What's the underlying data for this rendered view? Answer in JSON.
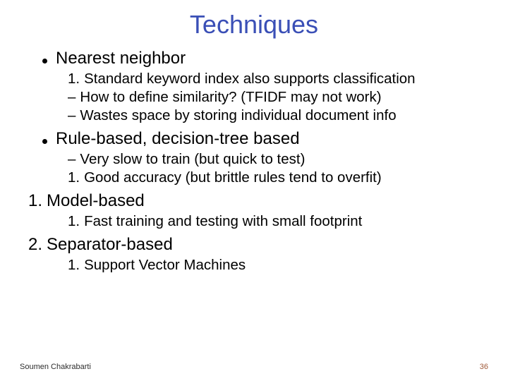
{
  "title": "Techniques",
  "sections": [
    {
      "style": "bullet",
      "heading": "Nearest neighbor",
      "items": [
        {
          "marker": "1.",
          "text": "Standard keyword index also supports classification"
        },
        {
          "marker": "–",
          "text": "How to define similarity? (TFIDF may not work)"
        },
        {
          "marker": "–",
          "text": "Wastes space by storing individual document info"
        }
      ]
    },
    {
      "style": "bullet",
      "heading": "Rule-based, decision-tree based",
      "items": [
        {
          "marker": "–",
          "text": "Very slow to train (but quick to test)"
        },
        {
          "marker": "1.",
          "text": "Good accuracy (but brittle rules tend to overfit)"
        }
      ]
    },
    {
      "style": "number",
      "number": "1.",
      "heading": "Model-based",
      "items": [
        {
          "marker": "1.",
          "text": "Fast training and testing with small footprint"
        }
      ]
    },
    {
      "style": "number",
      "number": "2.",
      "heading": "Separator-based",
      "items": [
        {
          "marker": "1.",
          "text": "Support Vector Machines"
        }
      ]
    }
  ],
  "footer": {
    "author": "Soumen Chakrabarti",
    "page": "36"
  }
}
